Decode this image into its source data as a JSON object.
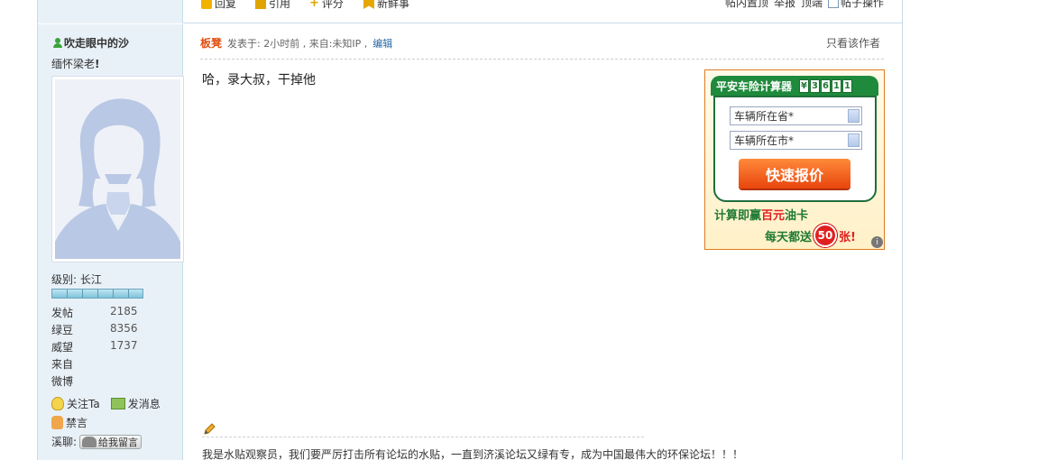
{
  "actions": {
    "reply": "回复",
    "quote": "引用",
    "rate": "评分",
    "fresh": "新鲜事"
  },
  "top_right": {
    "bump": "帖内置顶",
    "report": "举报",
    "top": "顶端",
    "post_ops": "帖子操作"
  },
  "user": {
    "name": "吹走眼中的沙",
    "signature": "缅怀梁老",
    "signature_mark": "!",
    "level_label": "级别: 长江",
    "stats": [
      {
        "key": "发帖",
        "value": "2185"
      },
      {
        "key": "绿豆",
        "value": "8356"
      },
      {
        "key": "威望",
        "value": "1737"
      },
      {
        "key": "来自",
        "value": ""
      },
      {
        "key": "微博",
        "value": ""
      }
    ],
    "follow": "关注Ta",
    "message": "发消息",
    "ban": "禁言",
    "chat_label": "溪聊:",
    "chat_button": "给我留言"
  },
  "post": {
    "author_tag": "板凳",
    "meta": "发表于: 2小时前 , 来自:未知IP ,",
    "edit": "编辑",
    "only_author": "只看该作者",
    "body": "哈，录大叔，干掉他",
    "signature": "我是水贴观察员，我们要严厉打击所有论坛的水贴，一直到济溪论坛又绿有专，成为中国最伟大的环保论坛！！！"
  },
  "ad": {
    "title": "平安车险计算器",
    "counter": [
      "¥",
      "3",
      "6",
      "1",
      "1"
    ],
    "province": "车辆所在省*",
    "city": "车辆所在市*",
    "quote_button": "快速报价",
    "line1_pre": "计算即赢",
    "line1_hl": "百元",
    "line1_post": "油卡",
    "line2": "每天都送",
    "fifty": "50",
    "zhang": "张!",
    "info": "i"
  },
  "colors": {
    "accent_orange": "#e04f12",
    "link_blue": "#2567a6",
    "ad_green": "#1f8a3c",
    "sidebar_bg": "#e9f1f8"
  }
}
